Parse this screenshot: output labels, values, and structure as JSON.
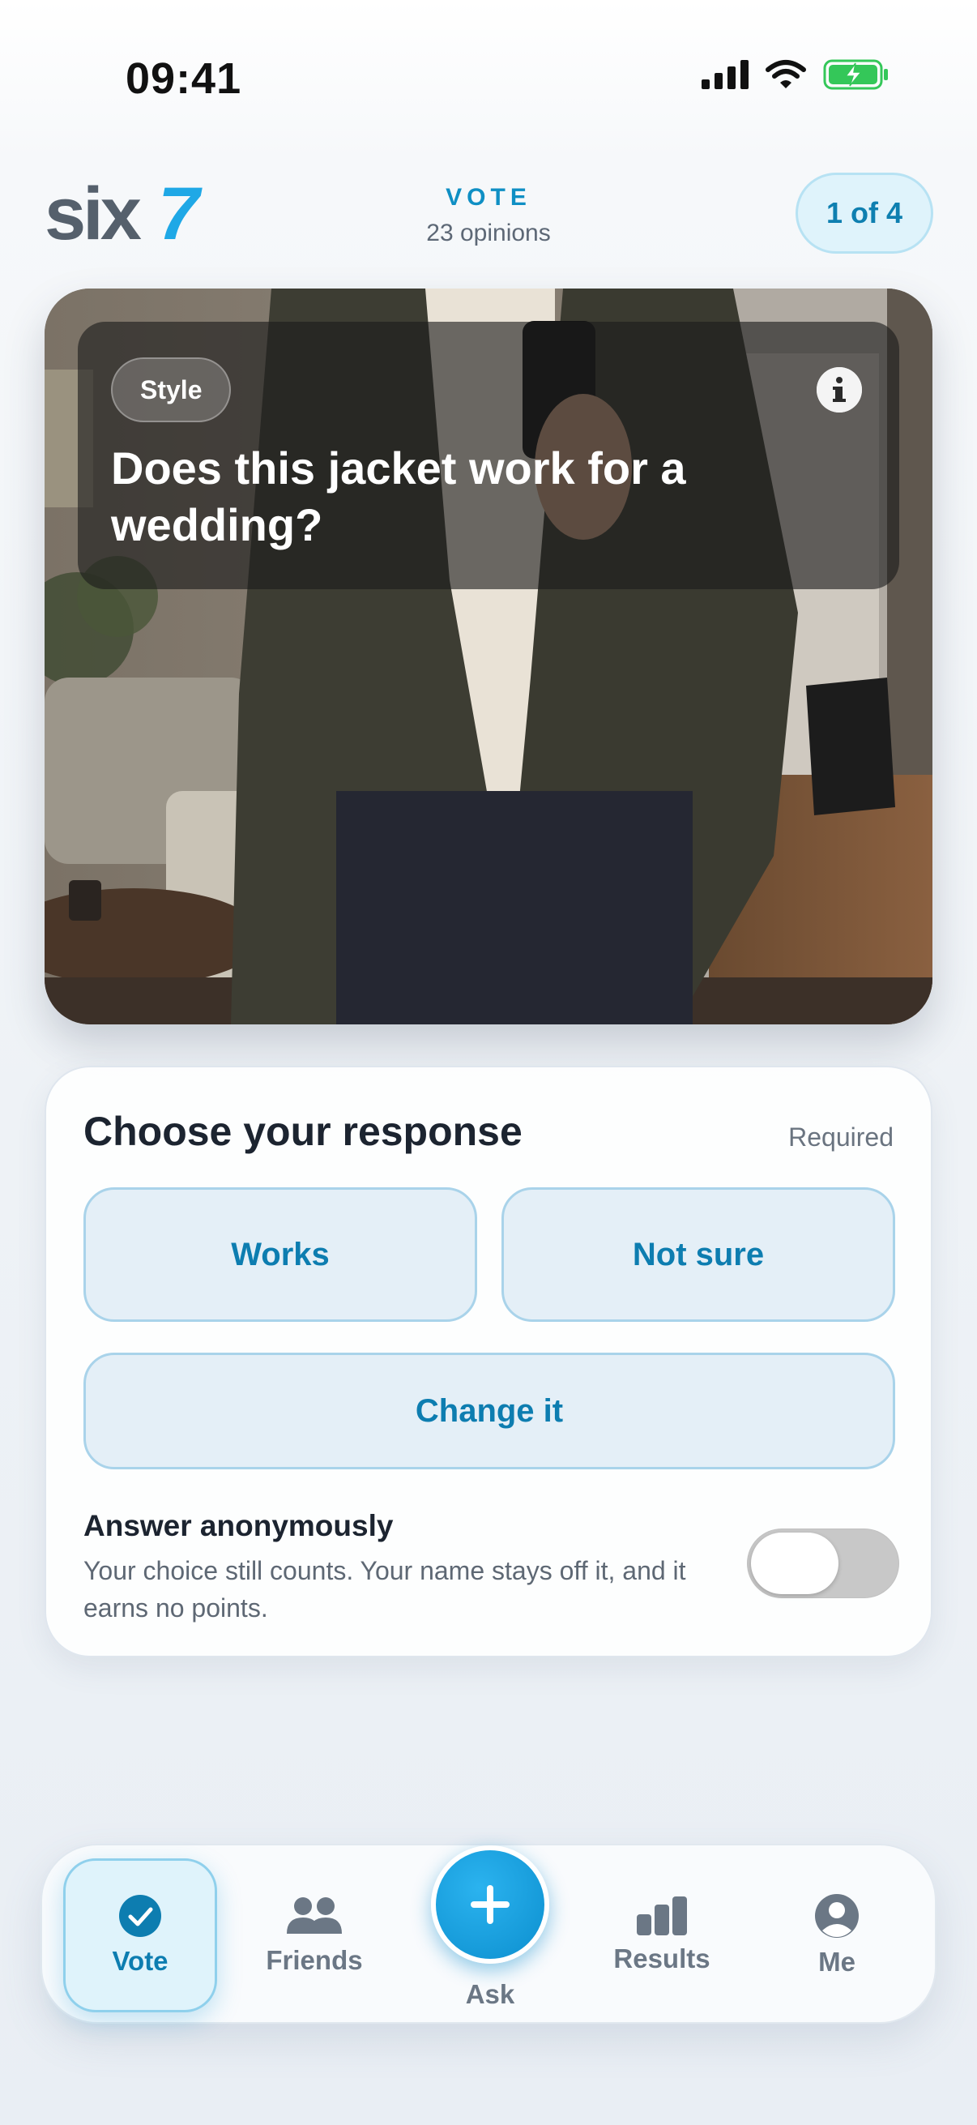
{
  "status_bar": {
    "time": "09:41"
  },
  "header": {
    "logo_text": "Six7",
    "title": "VOTE",
    "subtitle": "23 opinions",
    "counter": "1 of 4"
  },
  "post": {
    "topic": "Style",
    "question": "Does this jacket work for a wedding?"
  },
  "response": {
    "title": "Choose your response",
    "required_label": "Required",
    "options": [
      "Works",
      "Not sure",
      "Change it"
    ],
    "anonymous_title": "Answer anonymously",
    "anonymous_desc": "Your choice still counts. Your name stays off it, and it earns no points.",
    "anonymous_enabled": false
  },
  "tabs": [
    {
      "label": "Vote",
      "icon": "check-circle-icon",
      "active": true
    },
    {
      "label": "Friends",
      "icon": "people-icon",
      "active": false
    },
    {
      "label": "Ask",
      "icon": "plus-icon",
      "active": false
    },
    {
      "label": "Results",
      "icon": "bar-chart-icon",
      "active": false
    },
    {
      "label": "Me",
      "icon": "user-circle-icon",
      "active": false
    }
  ],
  "colors": {
    "accent": "#0f8fc4",
    "logo_gray": "#55606c",
    "logo_blue": "#1fa8e6",
    "battery_green": "#34c759"
  }
}
